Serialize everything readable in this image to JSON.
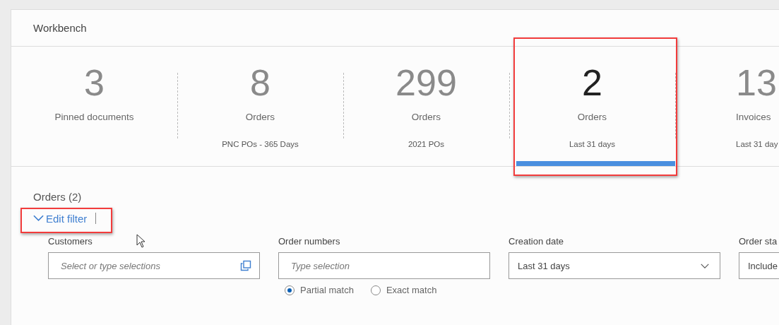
{
  "header": {
    "title": "Workbench"
  },
  "tiles": [
    {
      "count": "3",
      "label": "Pinned documents",
      "selected": false
    },
    {
      "count": "8",
      "label": "Orders",
      "subtitle": "PNC POs - 365 Days",
      "selected": false
    },
    {
      "count": "299",
      "label": "Orders",
      "subtitle": "2021 POs",
      "selected": false
    },
    {
      "count": "2",
      "label": "Orders",
      "subtitle": "Last 31 days",
      "selected": true
    },
    {
      "count": "13",
      "label": "Invoices",
      "subtitle": "Last 31 day",
      "selected": false
    }
  ],
  "section": {
    "title": "Orders (2)",
    "edit_filter": "Edit filter",
    "expanded": true
  },
  "filters": [
    {
      "kind": "valuehelp",
      "label": "Customers",
      "placeholder": "Select or type selections"
    },
    {
      "kind": "text",
      "label": "Order numbers",
      "placeholder": "Type selection",
      "options": [
        {
          "label": "Partial match",
          "selected": true
        },
        {
          "label": "Exact match",
          "selected": false
        }
      ]
    },
    {
      "kind": "select",
      "label": "Creation date",
      "value": "Last 31 days"
    },
    {
      "kind": "select",
      "label": "Order sta",
      "value": "Include"
    }
  ]
}
